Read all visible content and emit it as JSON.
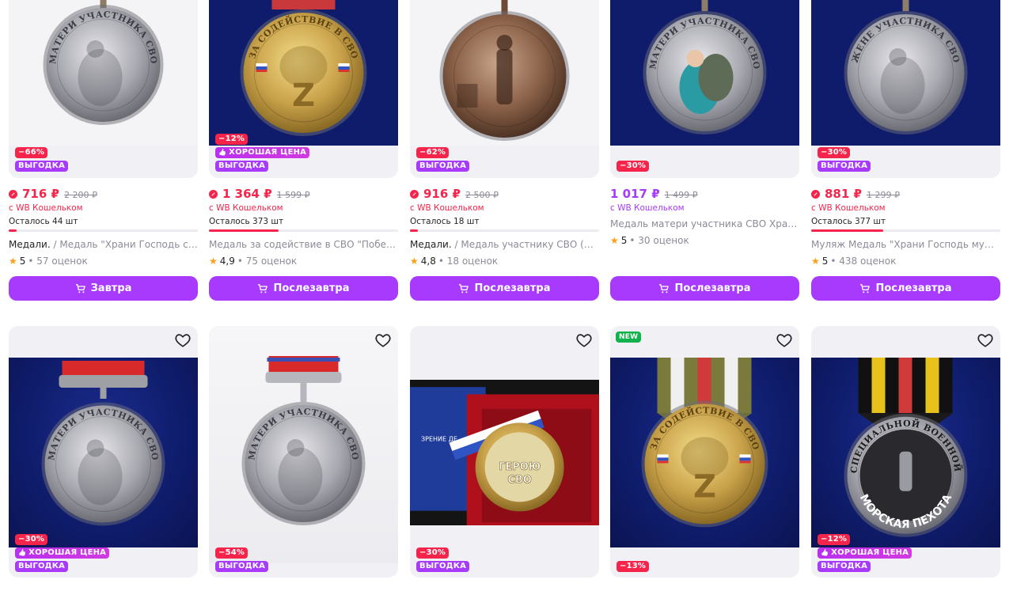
{
  "row1": [
    {
      "discount": "−66%",
      "good": "",
      "vyg": "ВЫГОДКА",
      "price": "716 ₽",
      "old": "2 200 ₽",
      "wallet": "с WB Кошельком",
      "stock": "Осталось 44 шт",
      "stock_fill": 0.04,
      "brand": "Медали.",
      "title": " / Медаль \"Храни Господь сыно...",
      "rating": "5",
      "reviews": "• 57 оценок",
      "button": "Завтра",
      "purple": false,
      "photo": "mother"
    },
    {
      "discount": "−12%",
      "good": "ХОРОШАЯ ЦЕНА",
      "vyg": "ВЫГОДКА",
      "price": "1 364 ₽",
      "old": "1 599 ₽",
      "wallet": "с WB Кошельком",
      "stock": "Осталось 373 шт",
      "stock_fill": 0.37,
      "brand": "",
      "title": "Медаль за содействие в СВО \"Победа б...",
      "rating": "4,9",
      "reviews": "• 75 оценок",
      "button": "Послезавтра",
      "purple": false,
      "photo": "gold"
    },
    {
      "discount": "−62%",
      "good": "",
      "vyg": "ВЫГОДКА",
      "price": "916 ₽",
      "old": "2 500 ₽",
      "wallet": "с WB Кошельком",
      "stock": "Осталось 18 шт",
      "stock_fill": 0.02,
      "brand": "Медали.",
      "title": " / Медаль участнику СВО (Муля...",
      "rating": "4,8",
      "reviews": "• 18 оценок",
      "button": "Послезавтра",
      "purple": false,
      "photo": "soldier"
    },
    {
      "discount": "−30%",
      "good": "",
      "vyg": "",
      "price": "1 017 ₽",
      "old": "1 499 ₽",
      "wallet": "с WB Кошельком",
      "stock": "",
      "stock_fill": 0,
      "brand": "",
      "title": "Медаль матери участника СВО Храни Г...",
      "rating": "5",
      "reviews": "• 30 оценок",
      "button": "Послезавтра",
      "purple": true,
      "photo": "mother-color"
    },
    {
      "discount": "−30%",
      "good": "",
      "vyg": "ВЫГОДКА",
      "price": "881 ₽",
      "old": "1 299 ₽",
      "wallet": "с WB Кошельком",
      "stock": "Осталось 377 шт",
      "stock_fill": 0.38,
      "brand": "",
      "title": "Муляж Медаль \"Храни Господь мужей л...",
      "rating": "5",
      "reviews": "• 438 оценок",
      "button": "Послезавтра",
      "purple": false,
      "photo": "wife"
    }
  ],
  "row2": [
    {
      "new": "",
      "discount": "−30%",
      "good": "ХОРОШАЯ ЦЕНА",
      "vyg": "ВЫГОДКА",
      "photo": "mother-ribbon"
    },
    {
      "new": "",
      "discount": "−54%",
      "good": "",
      "vyg": "ВЫГОДКА",
      "photo": "mother-silver"
    },
    {
      "new": "",
      "discount": "−30%",
      "good": "",
      "vyg": "ВЫГОДКА",
      "photo": "hero"
    },
    {
      "new": "NEW",
      "discount": "−13%",
      "good": "",
      "vyg": "",
      "photo": "gold-ribbon"
    },
    {
      "new": "",
      "discount": "−12%",
      "good": "ХОРОШАЯ ЦЕНА",
      "vyg": "ВЫГОДКА",
      "photo": "marine"
    }
  ],
  "medal_text": {
    "mother": "МАТЕРИ УЧАСТНИКА СВО",
    "wife": "ЖЕНЕ УЧАСТНИКА СВО",
    "assist": "ЗА СОДЕЙСТВИЕ В СВО",
    "hero": "ГЕРОЮ СВО",
    "marine": "МОРСКАЯ ПЕХОТА",
    "marine_top": "УЧАСТНИК СПЕЦИАЛЬНОЙ ВОЕННОЙ ОПЕРАЦИИ",
    "box_text": "ЗРЕНИЕ ДЕ"
  },
  "colors": {
    "purple": "#a73afd",
    "red": "#f5244b",
    "gray": "#8b8b99",
    "star": "#ff9e13"
  }
}
